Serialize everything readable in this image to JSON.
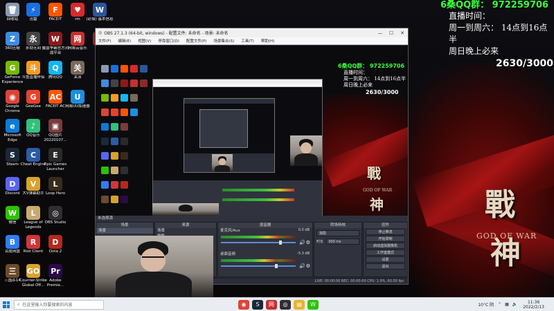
{
  "desktop": {
    "col1": [
      {
        "label": "回收站",
        "icon": "recycle-bin-icon",
        "color": "#8a9bb0",
        "glyph": "🗑"
      },
      {
        "label": "360压缩",
        "icon": "archive-icon",
        "color": "#3d8be0",
        "glyph": "Z"
      },
      {
        "label": "GeForce Experience",
        "icon": "geforce-icon",
        "color": "#76b900",
        "glyph": "G"
      },
      {
        "label": "Google Chrome",
        "icon": "chrome-icon",
        "color": "#db4437",
        "glyph": "◉"
      },
      {
        "label": "Microsoft Edge",
        "icon": "edge-icon",
        "color": "#0c7bd6",
        "glyph": "e"
      },
      {
        "label": "Steam",
        "icon": "steam-icon",
        "color": "#1b2838",
        "glyph": "S"
      },
      {
        "label": "Discord",
        "icon": "discord-icon",
        "color": "#5865f2",
        "glyph": "D"
      },
      {
        "label": "微信",
        "icon": "wechat-icon",
        "color": "#2dc100",
        "glyph": "W"
      },
      {
        "label": "百度网盘",
        "icon": "baidu-netdisk-icon",
        "color": "#2f7cf6",
        "glyph": "B"
      },
      {
        "label": "三国杀14",
        "icon": "game-icon",
        "color": "#6b4b2a",
        "glyph": "三"
      }
    ],
    "col2": [
      {
        "label": "迅雷",
        "icon": "thunder-icon",
        "color": "#1a6fe0",
        "glyph": "⚡"
      },
      {
        "label": "永劫无间",
        "icon": "naraka-icon",
        "color": "#444",
        "glyph": "永"
      },
      {
        "label": "斗鱼直播伴侣",
        "icon": "douyu-icon",
        "color": "#f59a23",
        "glyph": "斗"
      },
      {
        "label": "GeeGee",
        "icon": "geegee-icon",
        "color": "#e8412c",
        "glyph": "G"
      },
      {
        "label": "QQ音乐",
        "icon": "qq-music-icon",
        "color": "#31c27c",
        "glyph": "♪"
      },
      {
        "label": "Cheat Engine",
        "icon": "cheat-engine-icon",
        "color": "#2a5ca8",
        "glyph": "C"
      },
      {
        "label": "大V弹幕助手",
        "icon": "danmaku-icon",
        "color": "#d8a32a",
        "glyph": "V"
      },
      {
        "label": "League of Legends",
        "icon": "lol-icon",
        "color": "#c8aa6e",
        "glyph": "L"
      },
      {
        "label": "Riot Client",
        "icon": "riot-icon",
        "color": "#d13639",
        "glyph": "R"
      },
      {
        "label": "Counter-Strike Global Off...",
        "icon": "csgo-icon",
        "color": "#d8a32a",
        "glyph": "GO"
      }
    ],
    "col3": [
      {
        "label": "FACEIT",
        "icon": "faceit-icon",
        "color": "#ff5500",
        "glyph": "F"
      },
      {
        "label": "魔兽争霸官方对战平台",
        "icon": "warcraft-icon",
        "color": "#8b1a1a",
        "glyph": "W"
      },
      {
        "label": "腾讯QQ",
        "icon": "qq-icon",
        "color": "#12b7f5",
        "glyph": "Q"
      },
      {
        "label": "FACEIT AC",
        "icon": "faceit-ac-icon",
        "color": "#ff5500",
        "glyph": "AC"
      },
      {
        "label": "QQ图片20220107...",
        "icon": "image-file-icon",
        "color": "#7a3b3b",
        "glyph": "▣"
      },
      {
        "label": "Epic Games Launcher",
        "icon": "epic-icon",
        "color": "#2a2a2a",
        "glyph": "E"
      },
      {
        "label": "Loop Hero",
        "icon": "loop-hero-icon",
        "color": "#3a2a1a",
        "glyph": "L"
      },
      {
        "label": "OBS Studio",
        "icon": "obs-icon",
        "color": "#302e31",
        "glyph": "◎"
      },
      {
        "label": "Dota 2",
        "icon": "dota2-icon",
        "color": "#b5291c",
        "glyph": "D"
      },
      {
        "label": "Adobe Premie...",
        "icon": "premiere-icon",
        "color": "#2a0a4a",
        "glyph": "Pr"
      }
    ],
    "col4": [
      {
        "label": "rm",
        "icon": "heart-game-icon",
        "color": "#d82a2a",
        "glyph": "♥"
      },
      {
        "label": "网易云音乐",
        "icon": "netease-music-icon",
        "color": "#c62f2f",
        "glyph": "网"
      },
      {
        "label": "关羽",
        "icon": "photo-icon",
        "color": "#7a6a5a",
        "glyph": "关"
      },
      {
        "label": "网易UU加速器",
        "icon": "uu-booster-icon",
        "color": "#1a8fe0",
        "glyph": "U"
      }
    ],
    "col5": [
      {
        "label": "(必填) 基本信息",
        "icon": "word-icon",
        "color": "#2b579a",
        "glyph": "W"
      },
      {
        "label": "韩道",
        "icon": "app-icon",
        "color": "#8a2a2a",
        "glyph": "韩"
      }
    ],
    "wallpaper": {
      "title_top": "戰",
      "title_bottom": "神",
      "subtitle": "GOD OF WAR"
    }
  },
  "overlay": {
    "qq_group": "6桑QQ群：  972259706",
    "schedule_label": "直播时间：",
    "schedule_weekday": "周一到周六：  14点到16点半",
    "schedule_sunday": "周日晚上必来",
    "counter": "2630/3000",
    "qq_color": "#3cff3c"
  },
  "obs": {
    "title": "OBS 27.1.3 (64-bit, windows) - 配置文件: 未命名 - 场景: 未命名",
    "menu": [
      "文件(F)",
      "编辑(E)",
      "视图(V)",
      "停靠窗口(D)",
      "配置文件(P)",
      "场景集合(S)",
      "工具(T)",
      "帮助(H)"
    ],
    "dock_header": "未选择源",
    "scenes": {
      "header": "场景",
      "items": [
        "场景"
      ]
    },
    "sources": {
      "header": "来源",
      "items": [
        "场景",
        "摄像"
      ]
    },
    "mixer": {
      "header": "混音器",
      "tracks": [
        {
          "name": "麦克风/Aux",
          "db": "0.0 dB",
          "level": 0.78
        },
        {
          "name": "桌面音频",
          "db": "-5.3 dB",
          "level": 0.72
        }
      ]
    },
    "transitions": {
      "header": "转场特效",
      "type": "渐隐",
      "duration_label": "时长",
      "duration": "300 ms"
    },
    "controls": {
      "header": "控件",
      "buttons": [
        "停止推流",
        "开始录制",
        "启动虚拟摄像机",
        "工作室模式",
        "设置",
        "退出"
      ]
    },
    "status": "LIVE: 00:00:00    REC: 00:00:00    CPU: 1.9%, 60.00 fps"
  },
  "preview_overlay": {
    "qq_group": "6桑QQ群：  972259706",
    "schedule_label": "直播时间：",
    "schedule_weekday": "周一到周六：  14点到16点半",
    "schedule_sunday": "周日晚上必来",
    "counter": "2630/3000"
  },
  "taskbar": {
    "search_placeholder": "在这里输入你要搜索的内容",
    "apps": [
      {
        "icon": "chrome-icon",
        "color": "#db4437",
        "glyph": "◉"
      },
      {
        "icon": "steam-icon",
        "color": "#1b2838",
        "glyph": "S"
      },
      {
        "icon": "netease-music-icon",
        "color": "#c62f2f",
        "glyph": "网"
      },
      {
        "icon": "obs-icon",
        "color": "#302e31",
        "glyph": "◎"
      },
      {
        "icon": "file-explorer-icon",
        "color": "#e8b430",
        "glyph": "▤"
      },
      {
        "icon": "wechat-icon",
        "color": "#2dc100",
        "glyph": "W"
      }
    ],
    "weather": "10°C 阴",
    "time": "11:36",
    "date": "2022/2/13"
  }
}
